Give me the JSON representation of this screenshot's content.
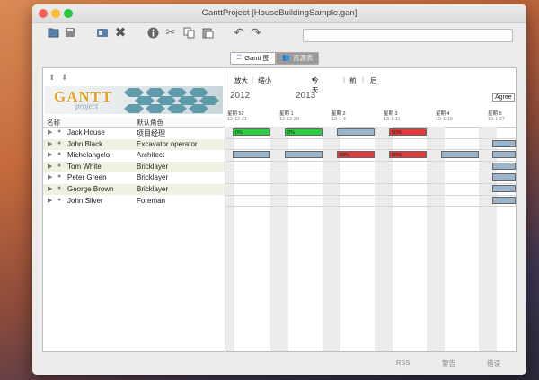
{
  "window": {
    "title": "GanttProject [HouseBuildingSample.gan]",
    "buttons": {
      "close_color": "#fc5f57",
      "minimize_color": "#fdbc2e",
      "maximize_color": "#27c840"
    }
  },
  "toolbar": {
    "icons": [
      "folder-open-icon",
      "save-icon",
      "resource-icon",
      "delete-icon",
      "info-icon",
      "cut-icon",
      "copy-icon",
      "paste-icon",
      "undo-icon",
      "redo-icon"
    ],
    "search_value": ""
  },
  "view_tabs": [
    {
      "label": "Gantt 图",
      "active": true
    },
    {
      "label": "资源表",
      "active": false
    }
  ],
  "resource_table": {
    "columns": [
      "名称",
      "默认角色"
    ],
    "rows": [
      {
        "name": "Jack House",
        "role": "项目经理"
      },
      {
        "name": "John Black",
        "role": "Excavator operator"
      },
      {
        "name": "Michelangelo",
        "role": "Architect"
      },
      {
        "name": "Tom White",
        "role": "Bricklayer"
      },
      {
        "name": "Peter Green",
        "role": "Bricklayer"
      },
      {
        "name": "George Brown",
        "role": "Bricklayer"
      },
      {
        "name": "John Silver",
        "role": "Foreman"
      }
    ]
  },
  "chart_toolbar": {
    "zoom_in": "放大",
    "zoom_out": "缩小",
    "today": "今天",
    "prev": "前",
    "next": "后"
  },
  "timeline": {
    "years": [
      "2012",
      "2013"
    ],
    "right_label": "Agree",
    "weeks": [
      {
        "week": "星期 52",
        "date": "12-12-21"
      },
      {
        "week": "星期 1",
        "date": "12-12-28"
      },
      {
        "week": "星期 2",
        "date": "13-1-4"
      },
      {
        "week": "星期 3",
        "date": "13-1-11"
      },
      {
        "week": "星期 4",
        "date": "13-1-18"
      },
      {
        "week": "星期 5",
        "date": "13-1-27"
      }
    ]
  },
  "load_labels": {
    "row0_a": "0%",
    "row0_b": "0%",
    "row0_c": "50%",
    "row2_a": "50%",
    "row2_b": "50%"
  },
  "status_bar": {
    "rss": "RSS",
    "warnings": "警告",
    "errors": "错误"
  }
}
